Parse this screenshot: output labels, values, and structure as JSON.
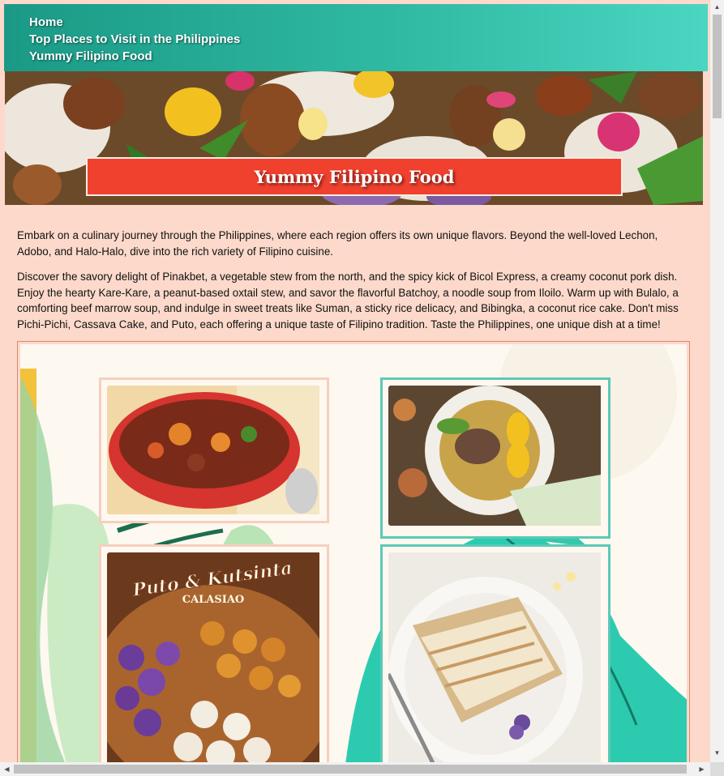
{
  "nav": {
    "items": [
      {
        "label": "Home"
      },
      {
        "label": "Top Places to Visit in the Philippines"
      },
      {
        "label": "Yummy Filipino Food"
      }
    ]
  },
  "hero": {
    "title": "Yummy Filipino Food"
  },
  "content": {
    "paragraphs": [
      "Embark on a culinary journey through the Philippines, where each region offers its own unique flavors. Beyond the well-loved Lechon, Adobo, and Halo-Halo, dive into the rich variety of Filipino cuisine.",
      "Discover the savory delight of Pinakbet, a vegetable stew from the north, and the spicy kick of Bicol Express, a creamy coconut pork dish. Enjoy the hearty Kare-Kare, a peanut-based oxtail stew, and savor the flavorful Batchoy, a noodle soup from Iloilo. Warm up with Bulalo, a comforting beef marrow soup, and indulge in sweet treats like Suman, a sticky rice delicacy, and Bibingka, a coconut rice cake. Don't miss Pichi-Pichi, Cassava Cake, and Puto, each offering a unique taste of Filipino tradition. Taste the Philippines, one unique dish at a time!"
    ]
  },
  "gallery": {
    "poster_title": "Puto & Kutsinta",
    "poster_subtitle": "CALASIAO"
  },
  "colors": {
    "nav_start": "#1a9a86",
    "nav_end": "#4bd6c2",
    "banner": "#f0402e",
    "page_bg": "#fcd9cb",
    "frame_teal": "#5cc9b5",
    "frame_peach": "#f6cfbf"
  },
  "scrollbars": {
    "up_icon": "triangle-up",
    "down_icon": "triangle-down",
    "left_icon": "triangle-left",
    "right_icon": "triangle-right"
  }
}
